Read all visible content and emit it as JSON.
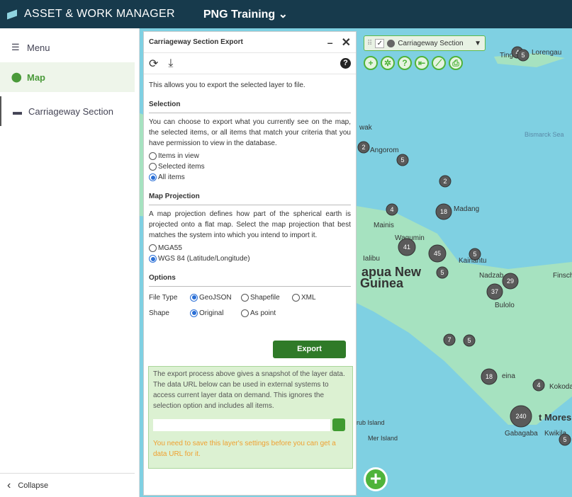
{
  "header": {
    "app_title": "ASSET & WORK MANAGER",
    "org": "PNG Training"
  },
  "sidebar": {
    "items": [
      {
        "label": "Menu",
        "icon": "hamburger-icon"
      },
      {
        "label": "Map",
        "icon": "map-pin-icon",
        "active": true
      },
      {
        "label": "Carriageway Section",
        "icon": "road-icon"
      }
    ],
    "collapse": "Collapse"
  },
  "dialog": {
    "title": "Carriageway Section Export",
    "intro": "This allows you to export the selected layer to file.",
    "selection": {
      "heading": "Selection",
      "desc": "You can choose to export what you currently see on the map, the selected items, or all items that match your criteria that you have permission to view in the database.",
      "options": [
        "Items in view",
        "Selected items",
        "All items"
      ],
      "selected": "All items"
    },
    "projection": {
      "heading": "Map Projection",
      "desc": "A map projection defines how part of the spherical earth is projected onto a flat map. Select the map projection that best matches the system into which you intend to import it.",
      "options": [
        "MGA55",
        "WGS 84 (Latitude/Longitude)"
      ],
      "selected": "WGS 84 (Latitude/Longitude)"
    },
    "options": {
      "heading": "Options",
      "file_type_label": "File Type",
      "file_types": [
        "GeoJSON",
        "Shapefile",
        "XML"
      ],
      "file_type_selected": "GeoJSON",
      "shape_label": "Shape",
      "shapes": [
        "Original",
        "As point"
      ],
      "shape_selected": "Original"
    },
    "export_label": "Export",
    "info": {
      "text": "The export process above gives a snapshot of the layer data. The data URL below can be used in external systems to access current layer data on demand. This ignores the selection option and includes all items.",
      "url_value": "",
      "warning": "You need to save this layer's settings before you can get a data URL for it."
    }
  },
  "map": {
    "layer_label": "Carriageway Section",
    "tools": [
      "add-icon",
      "settings-icon",
      "help-icon",
      "back-icon",
      "ruler-icon",
      "print-icon"
    ],
    "clusters": [
      "4",
      "5",
      "2",
      "5",
      "2",
      "4",
      "18",
      "41",
      "45",
      "5",
      "5",
      "29",
      "37",
      "7",
      "5",
      "18",
      "4",
      "240",
      "5"
    ],
    "labels": [
      "Tingou",
      "Lorengau",
      "Bismarck Sea",
      "wak",
      "Angorom",
      "Madang",
      "Mainis",
      "Wagumin",
      "Kainantu",
      "Ialibu",
      "apua New",
      "Guinea",
      "Nadzab",
      "Finsch",
      "Bulolo",
      "eina",
      "Kokoda",
      "t Moresby",
      "Gabagaba",
      "Kwikila",
      "rub Island",
      "Mer Island"
    ],
    "colors": {
      "sea": "#7fd0e2",
      "land": "#a6e2c0",
      "cluster": "#5a5a5a",
      "accent": "#4fb33a"
    }
  }
}
